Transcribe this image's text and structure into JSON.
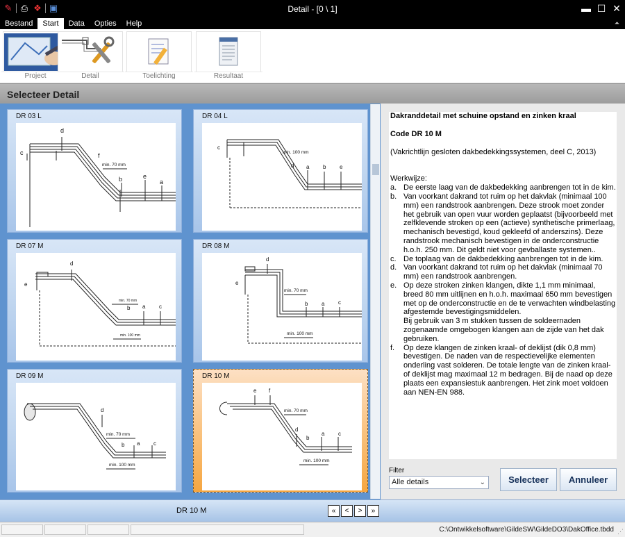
{
  "window": {
    "title": "Detail - [0 \\ 1]"
  },
  "menu": [
    "Bestand",
    "Start",
    "Data",
    "Opties",
    "Help"
  ],
  "ribbon": {
    "buttons": [
      {
        "label": "Project"
      },
      {
        "label": "Detail"
      },
      {
        "label": "Toelichting"
      },
      {
        "label": "Resultaat"
      }
    ]
  },
  "section": {
    "title": "Selecteer Detail"
  },
  "gallery": {
    "tiles": [
      {
        "name": "DR 03 L",
        "labels": [
          "c",
          "d",
          "f",
          "min. 70 mm",
          "b",
          "e",
          "a"
        ]
      },
      {
        "name": "DR 04 L",
        "labels": [
          "c",
          "min. 100 mm",
          "d",
          "a",
          "b",
          "e"
        ]
      },
      {
        "name": "DR 07 M",
        "labels": [
          "e",
          "d",
          "min. 70 mm",
          "b",
          "a",
          "c",
          "min. 100 mm"
        ]
      },
      {
        "name": "DR 08 M",
        "labels": [
          "e",
          "d",
          "min. 70 mm",
          "b",
          "a",
          "c",
          "min. 100 mm"
        ]
      },
      {
        "name": "DR 09 M",
        "labels": [
          "d",
          "min. 70 mm",
          "b",
          "a",
          "c",
          "min. 100 mm"
        ]
      },
      {
        "name": "DR 10 M",
        "labels": [
          "e",
          "f",
          "min. 70 mm",
          "d",
          "b",
          "a",
          "c",
          "min. 100 mm"
        ]
      }
    ]
  },
  "detail": {
    "heading": "Dakranddetail met schuine opstand en zinken kraal",
    "code": "Code DR 10 M",
    "source": "(Vakrichtlijn gesloten dakbedekkingssystemen, deel C, 2013)",
    "werkwijze_label": "Werkwijze:",
    "steps": [
      {
        "k": "a.",
        "v": "De eerste laag van de dakbedekking aanbrengen tot in de kim."
      },
      {
        "k": "b.",
        "v": "Van voorkant dakrand tot ruim op het dakvlak (minimaal 100 mm) een randstrook aanbrengen. Deze strook moet zonder het gebruik van open vuur worden geplaatst (bijvoorbeeld met zelfklevende stroken op een (actieve) synthetische primerlaag, mechanisch bevestigd, koud gekleefd of anderszins). Deze randstrook mechanisch bevestigen in de onderconstructie h.o.h. 250 mm. Dit geldt niet voor gevballaste systemen.."
      },
      {
        "k": "c.",
        "v": "De toplaag van de dakbedekking aanbrengen tot in de kim."
      },
      {
        "k": "d.",
        "v": "Van voorkant dakrand tot ruim op het dakvlak (minimaal 70 mm) een randstrook aanbrengen."
      },
      {
        "k": "e.",
        "v": "Op deze stroken zinken klangen, dikte 1,1 mm minimaal, breed 80 mm uitlijnen en h.o.h. maximaal 650 mm bevestigen met op de onderconstructie en de te verwachten windbelasting afgestemde bevestigingsmiddelen."
      },
      {
        "k": "",
        "v": "Bij gebruik van 3 m stukken tussen de soldeernaden zogenaamde omgebogen klangen aan de zijde van het dak gebruiken."
      },
      {
        "k": "f.",
        "v": "Op deze klangen de zinken kraal- of deklijst (dik 0,8 mm) bevestigen. De naden van de respectievelijke elementen onderling vast solderen. De totale lengte van de zinken kraal- of deklijst mag maximaal 12 m bedragen. Bij de naad op deze plaats een expansiestuk aanbrengen. Het zink moet voldoen aan NEN-EN 988."
      }
    ]
  },
  "filter": {
    "label": "Filter",
    "value": "Alle details"
  },
  "actions": {
    "select": "Selecteer",
    "cancel": "Annuleer"
  },
  "nav": {
    "current": "DR 10 M",
    "first": "«",
    "prev": "<",
    "next": ">",
    "last": "»"
  },
  "status": {
    "path": "C:\\Ontwikkelsoftware\\GildeSW\\GildeDO3\\DakOffice.tbdd"
  },
  "colors": {
    "gallery_bg": "#5f93cf",
    "tile_bg": "#bcd3ee",
    "tile_selected_bg": "#f9c07a",
    "button_text": "#16315a"
  }
}
